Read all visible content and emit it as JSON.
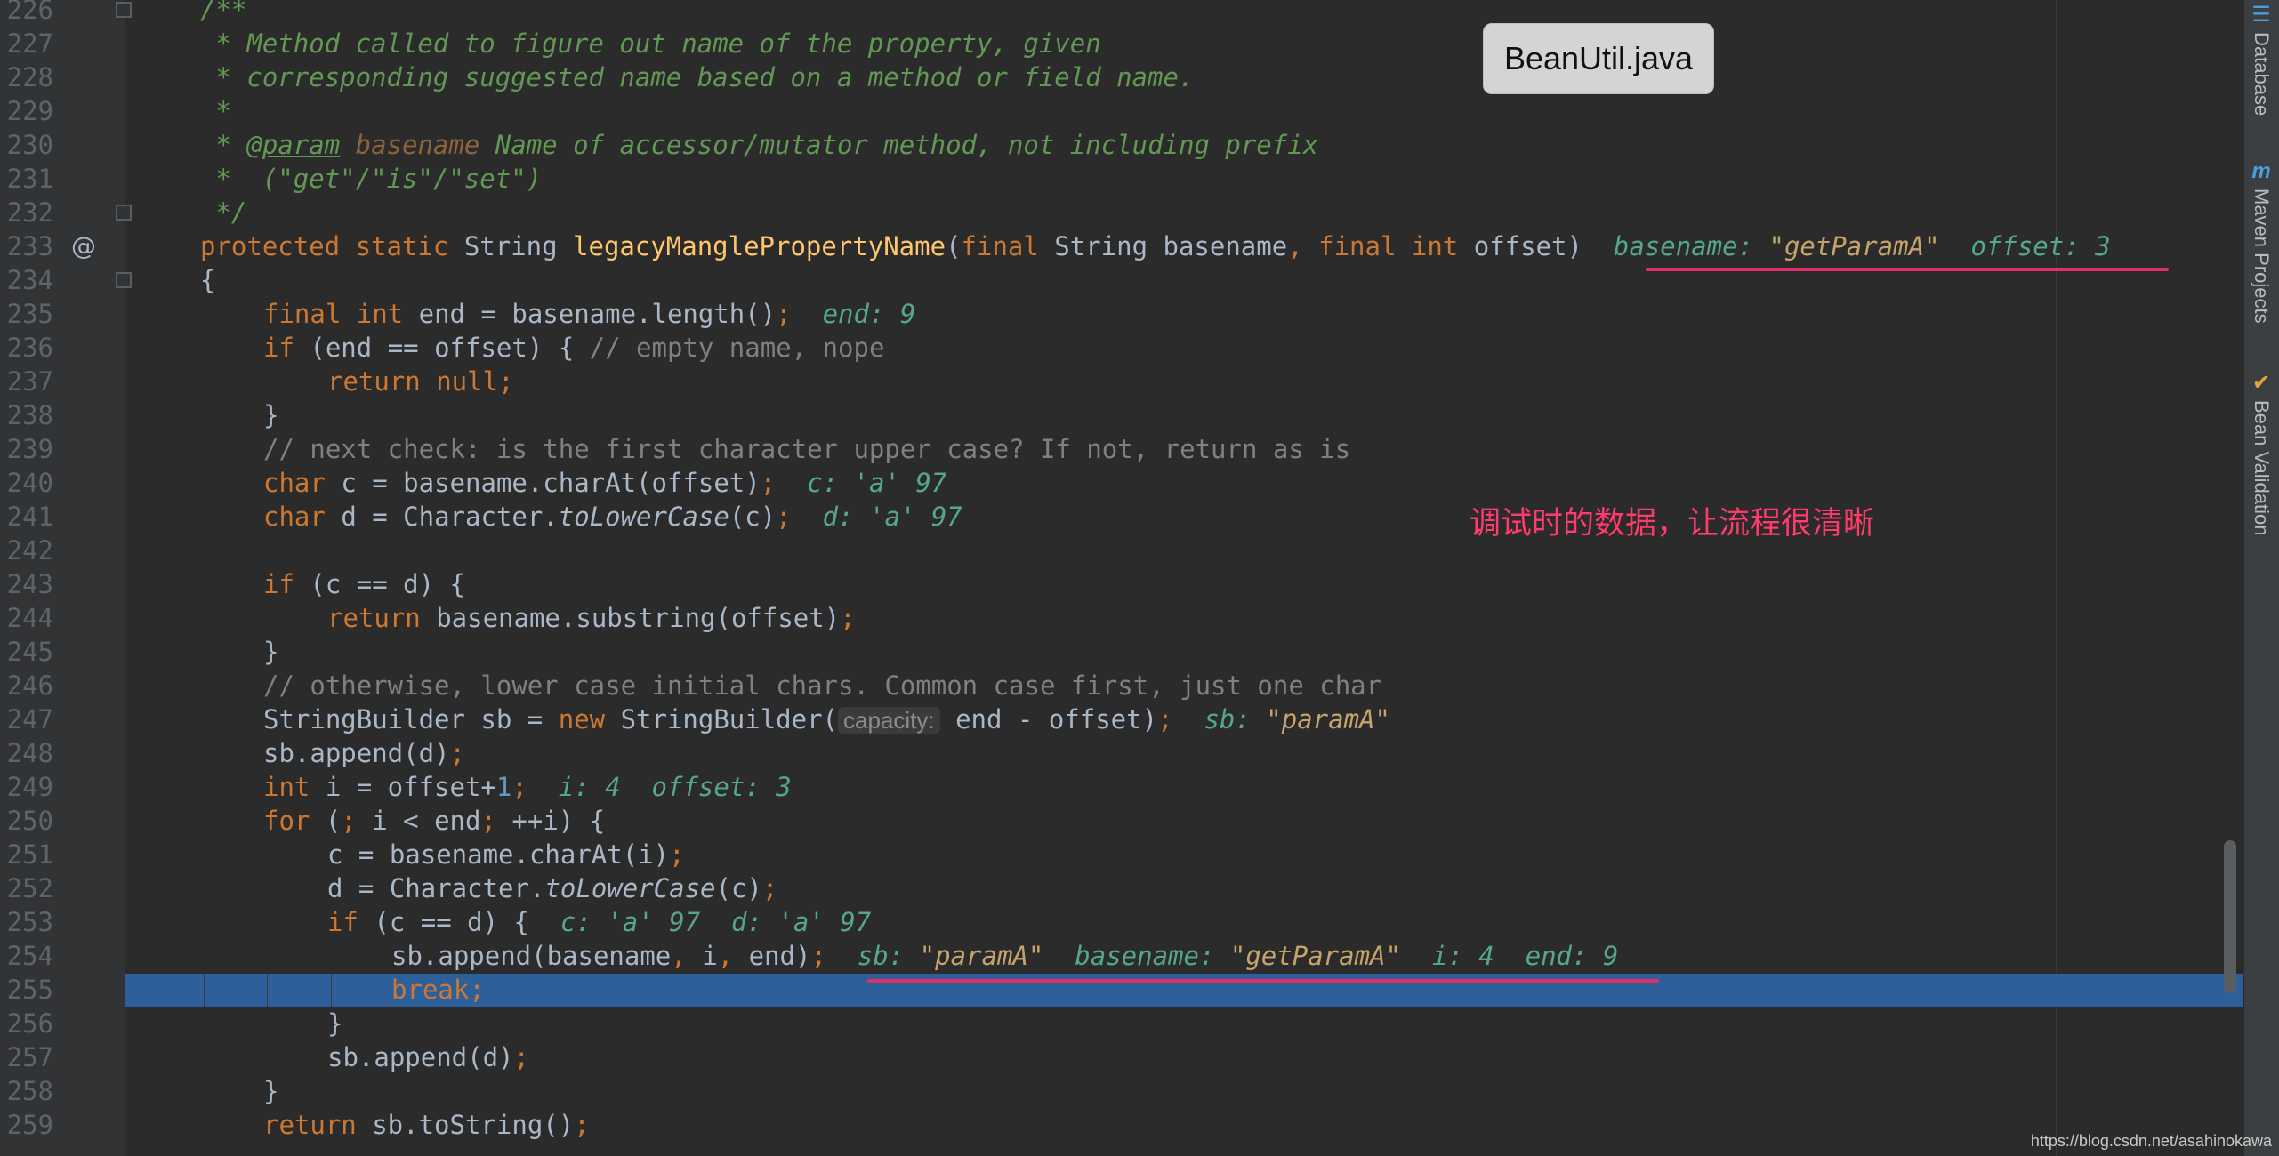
{
  "file_badge": "BeanUtil.java",
  "annotation": "调试时的数据，让流程很清晰",
  "watermark": "https://blog.csdn.net/asahinokawa",
  "side_panel": {
    "database": "Database",
    "maven": "Maven Projects",
    "bean_validation": "Bean Validation"
  },
  "gutter": {
    "override_marker": "@"
  },
  "line_numbers": [
    "226",
    "227",
    "228",
    "229",
    "230",
    "231",
    "232",
    "233",
    "234",
    "235",
    "236",
    "237",
    "238",
    "239",
    "240",
    "241",
    "242",
    "243",
    "244",
    "245",
    "246",
    "247",
    "248",
    "249",
    "250",
    "251",
    "252",
    "253",
    "254",
    "255",
    "256",
    "257",
    "258",
    "259"
  ],
  "code": {
    "l226": "/**",
    "l227": " * Method called to figure out name of the property, given",
    "l228": " * corresponding suggested name based on a method or field name.",
    "l229": " *",
    "l230_a": " * ",
    "l230_tag": "@param",
    "l230_b": " ",
    "l230_pn": "basename",
    "l230_c": " Name of accessor/mutator method, not including prefix",
    "l231": " *  (\"get\"/\"is\"/\"set\")",
    "l232": " */",
    "l233_k1": "protected static ",
    "l233_t1": "String ",
    "l233_fn": "legacyManglePropertyName",
    "l233_p1": "(",
    "l233_k2": "final ",
    "l233_t2": "String basename",
    "l233_c1": ", ",
    "l233_k3": "final int ",
    "l233_t3": "offset)",
    "l233_hint1": "basename: ",
    "l233_hint1v": "\"getParamA\"",
    "l233_hint2": "offset: 3",
    "l234": "{",
    "l235_k": "final int ",
    "l235_t": "end = basename.length()",
    "l235_s": ";",
    "l235_hint": "end: 9",
    "l236_k": "if ",
    "l236_t": "(end == offset) { ",
    "l236_c": "// empty name, nope",
    "l237_k": "return null",
    "l237_s": ";",
    "l238": "}",
    "l239": "// next check: is the first character upper case? If not, return as is",
    "l240_k": "char ",
    "l240_t": "c = basename.charAt(offset)",
    "l240_s": ";",
    "l240_hint": "c: ",
    "l240_hintv": "'a' 97",
    "l241_k": "char ",
    "l241_t1": "d = Character.",
    "l241_it": "toLowerCase",
    "l241_t2": "(c)",
    "l241_s": ";",
    "l241_hint": "d: ",
    "l241_hintv": "'a' 97",
    "l243_k": "if ",
    "l243_t": "(c == d) {",
    "l244_k": "return ",
    "l244_t": "basename.substring(offset)",
    "l244_s": ";",
    "l245": "}",
    "l246": "// otherwise, lower case initial chars. Common case first, just one char",
    "l247_t1": "StringBuilder sb = ",
    "l247_k": "new ",
    "l247_t2": "StringBuilder(",
    "l247_param": "capacity:",
    "l247_t3": " end - offset)",
    "l247_s": ";",
    "l247_hint": "sb: ",
    "l247_hintv": "\"paramA\"",
    "l248_t": "sb.append(d)",
    "l248_s": ";",
    "l249_k": "int ",
    "l249_t": "i = offset+",
    "l249_n": "1",
    "l249_s": ";",
    "l249_hint": "i: 4  offset: 3",
    "l250_k": "for ",
    "l250_t1": "(",
    "l250_s1": ";",
    "l250_t2": " i < end",
    "l250_s2": ";",
    "l250_t3": " ++i) {",
    "l251_t": "c = basename.charAt(i)",
    "l251_s": ";",
    "l252_t1": "d = Character.",
    "l252_it": "toLowerCase",
    "l252_t2": "(c)",
    "l252_s": ";",
    "l253_k": "if ",
    "l253_t": "(c == d) {",
    "l253_hint1": "c: ",
    "l253_hint1v": "'a' 97",
    "l253_hint2": "d: ",
    "l253_hint2v": "'a' 97",
    "l254_t1": "sb.append(basename",
    "l254_c1": ", ",
    "l254_t2": "i",
    "l254_c2": ", ",
    "l254_t3": "end)",
    "l254_s": ";",
    "l254_hint1": "sb: ",
    "l254_hint1v": "\"paramA\"",
    "l254_hint2": "basename: ",
    "l254_hint2v": "\"getParamA\"",
    "l254_hint3": "i: 4  end: 9",
    "l255_k": "break",
    "l255_s": ";",
    "l256": "}",
    "l257_t": "sb.append(d)",
    "l257_s": ";",
    "l258": "}",
    "l259_k": "return ",
    "l259_t": "sb.toString()",
    "l259_s": ";"
  }
}
